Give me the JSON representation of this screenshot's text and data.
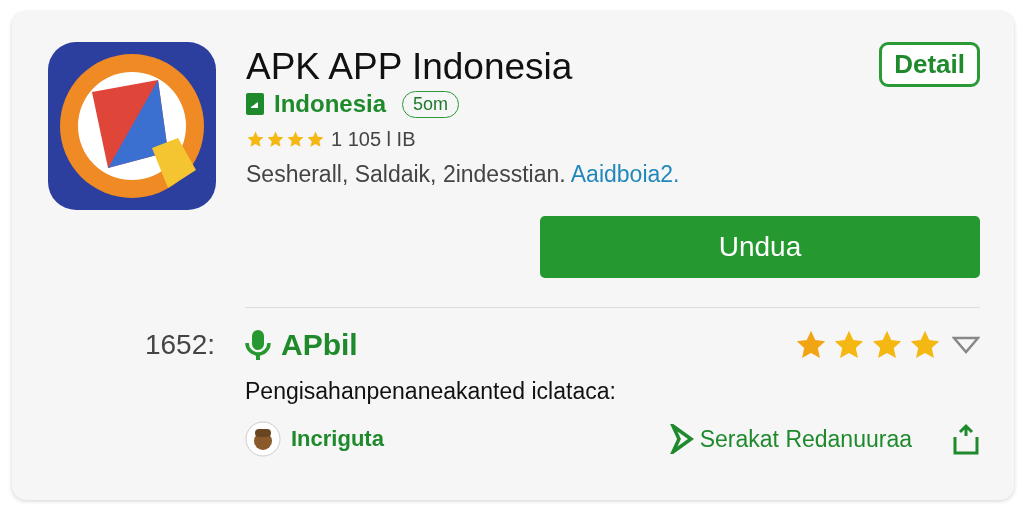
{
  "app": {
    "title": "APK APP Indonesia",
    "detail_button": "Detail",
    "publisher": "Indonesia",
    "badge": "5om",
    "stars": 4,
    "rating_info": "1  105 l IB",
    "tags": "Sesherall,  Saldaik,  2indesstian.",
    "tag_link": "Aaidboia2.",
    "download_button": "Undua"
  },
  "review": {
    "number": "1652:",
    "name": "APbil",
    "stars": 4,
    "text": "Pengisahanpenaneakanted iclataca:",
    "author": "Incriguta",
    "action": "Serakat Redanuuraa"
  }
}
